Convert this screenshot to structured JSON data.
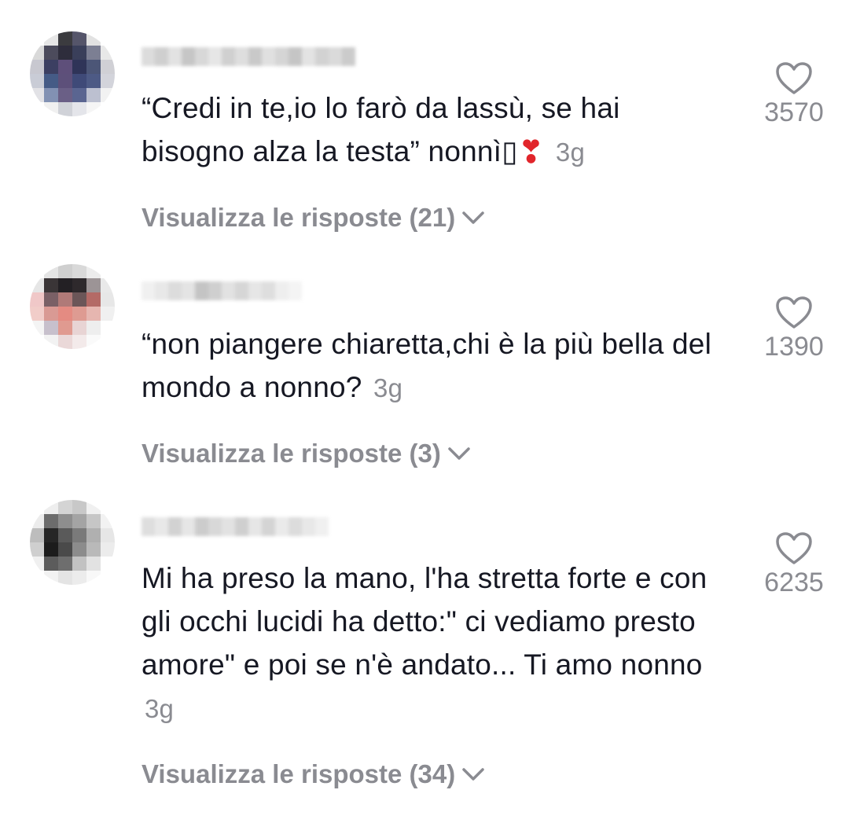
{
  "comments": [
    {
      "text": "“Credi in te,io lo farò da lassù, se hai bisogno alza la testa” nonnì",
      "glyph": "▯",
      "emoji": "❣",
      "time": "3g",
      "likes": "3570",
      "replies_label": "Visualizza le risposte (21)"
    },
    {
      "text": "“non piangere chiaretta,chi è la più bella del mondo a nonno?",
      "time": "3g",
      "likes": "1390",
      "replies_label": "Visualizza le risposte (3)"
    },
    {
      "text": "Mi ha preso la mano, l'ha stretta forte e con gli occhi lucidi ha detto:\" ci vediamo presto amore\" e poi se n'è andato... Ti amo nonno",
      "time": "3g",
      "likes": "6235",
      "replies_label": "Visualizza le risposte (34)"
    }
  ],
  "colors": {
    "text": "#161823",
    "secondary": "#8a8b91",
    "heart_emoji": "#e1252b",
    "background": "#ffffff"
  },
  "icons": {
    "like": "heart-outline-icon",
    "expand": "chevron-down-icon"
  }
}
